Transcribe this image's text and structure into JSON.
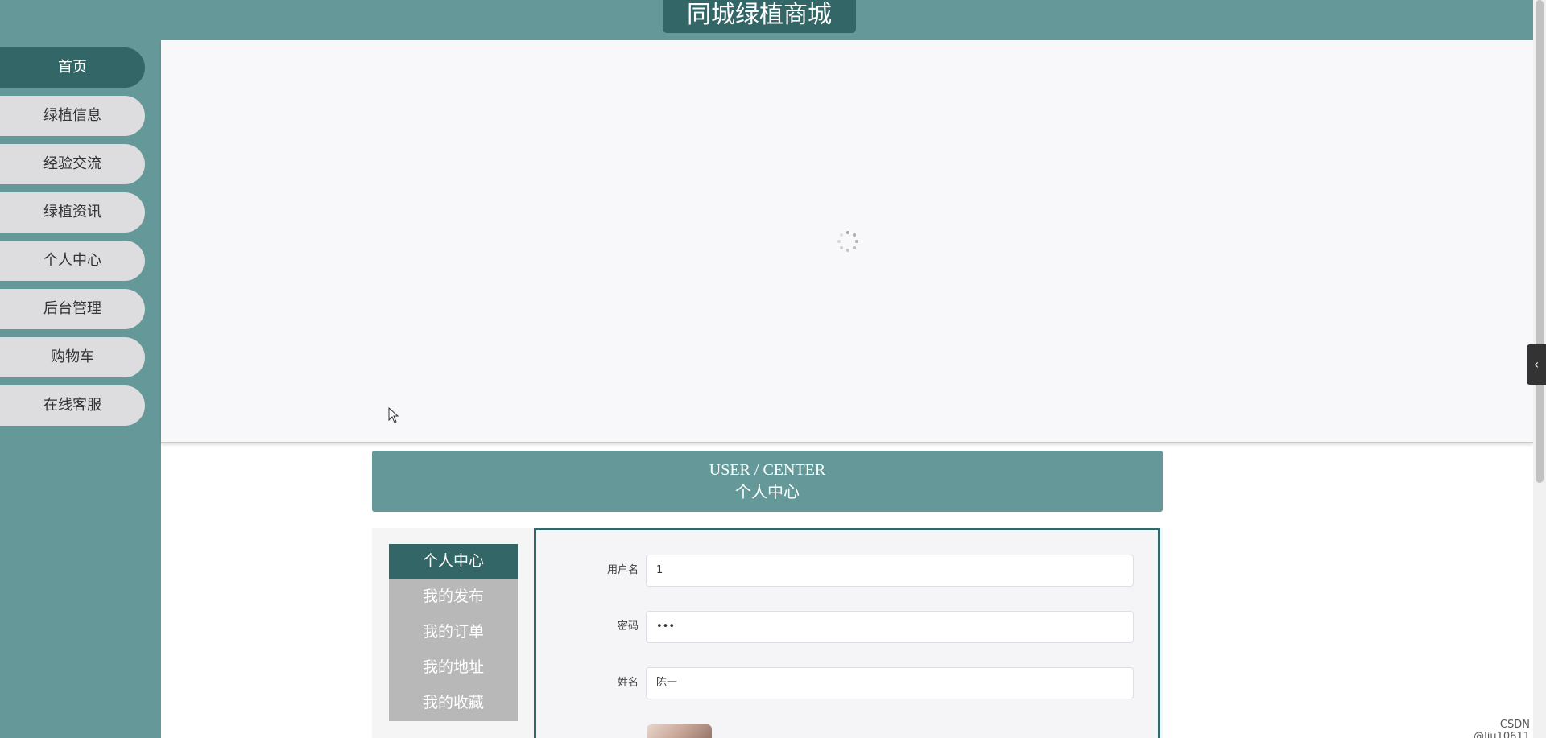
{
  "header": {
    "title": "同城绿植商城"
  },
  "nav": {
    "items": [
      {
        "label": "首页",
        "active": true
      },
      {
        "label": "绿植信息",
        "active": false
      },
      {
        "label": "经验交流",
        "active": false
      },
      {
        "label": "绿植资讯",
        "active": false
      },
      {
        "label": "个人中心",
        "active": false
      },
      {
        "label": "后台管理",
        "active": false
      },
      {
        "label": "购物车",
        "active": false
      },
      {
        "label": "在线客服",
        "active": false
      }
    ]
  },
  "banner": {
    "state": "loading",
    "icon": "loading-spinner-icon"
  },
  "section": {
    "en_title": "USER / CENTER",
    "cn_title": "个人中心"
  },
  "center_menu": {
    "items": [
      {
        "label": "个人中心",
        "active": true
      },
      {
        "label": "我的发布",
        "active": false
      },
      {
        "label": "我的订单",
        "active": false
      },
      {
        "label": "我的地址",
        "active": false
      },
      {
        "label": "我的收藏",
        "active": false
      }
    ]
  },
  "form": {
    "username": {
      "label": "用户名",
      "value": "1"
    },
    "password": {
      "label": "密码",
      "value": "•••"
    },
    "name": {
      "label": "姓名",
      "value": "陈一"
    }
  },
  "side_toggle": {
    "label": "‹"
  },
  "watermark": {
    "text": "CSDN @liu10611"
  },
  "colors": {
    "primary": "#659999",
    "primary_dark": "#336666",
    "nav_inactive": "#dddcdf",
    "menu_inactive": "#b8b8b8"
  }
}
